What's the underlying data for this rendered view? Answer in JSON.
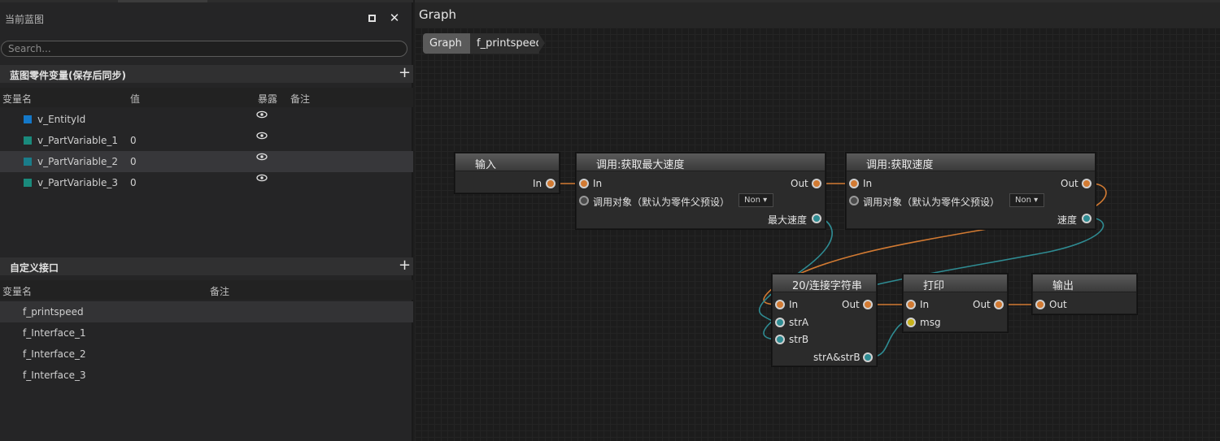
{
  "left_panel": {
    "title": "当前蓝图",
    "search_placeholder": "Search...",
    "variables_section": {
      "title": "蓝图零件变量(保存后同步)",
      "col_name": "变量名",
      "col_value": "值",
      "col_expose": "暴露",
      "col_note": "备注",
      "items": [
        {
          "name": "v_EntityId",
          "value": "",
          "color": "#1478c8"
        },
        {
          "name": "v_PartVariable_1",
          "value": "0",
          "color": "#1a8a7c"
        },
        {
          "name": "v_PartVariable_2",
          "value": "0",
          "color": "#1a7d8a"
        },
        {
          "name": "v_PartVariable_3",
          "value": "0",
          "color": "#1a8a7c"
        }
      ]
    },
    "interface_section": {
      "title": "自定义接口",
      "col_name": "变量名",
      "col_note": "备注",
      "items": [
        {
          "name": "f_printspeed"
        },
        {
          "name": "f_Interface_1"
        },
        {
          "name": "f_Interface_2"
        },
        {
          "name": "f_Interface_3"
        }
      ]
    }
  },
  "graph": {
    "title": "Graph",
    "breadcrumbs": [
      "Graph",
      "f_printspeed"
    ],
    "nodes": {
      "input": {
        "title": "输入",
        "out_in": "In"
      },
      "get_max_speed": {
        "title": "调用:获取最大速度",
        "in": "In",
        "out": "Out",
        "target": "调用对象（默认为零件父预设）",
        "dropdown": "Non ▾",
        "result": "最大速度"
      },
      "get_speed": {
        "title": "调用:获取速度",
        "in": "In",
        "out": "Out",
        "target": "调用对象（默认为零件父预设）",
        "dropdown": "Non ▾",
        "result": "速度"
      },
      "concat": {
        "title": "20/连接字符串",
        "in": "In",
        "out": "Out",
        "a": "strA",
        "b": "strB",
        "result": "strA&strB"
      },
      "print": {
        "title": "打印",
        "in": "In",
        "out": "Out",
        "msg": "msg"
      },
      "output": {
        "title": "输出",
        "out": "Out"
      }
    },
    "colors": {
      "exec": "#d27a32",
      "data": "#2f8c93",
      "string": "#c7b21b"
    }
  }
}
